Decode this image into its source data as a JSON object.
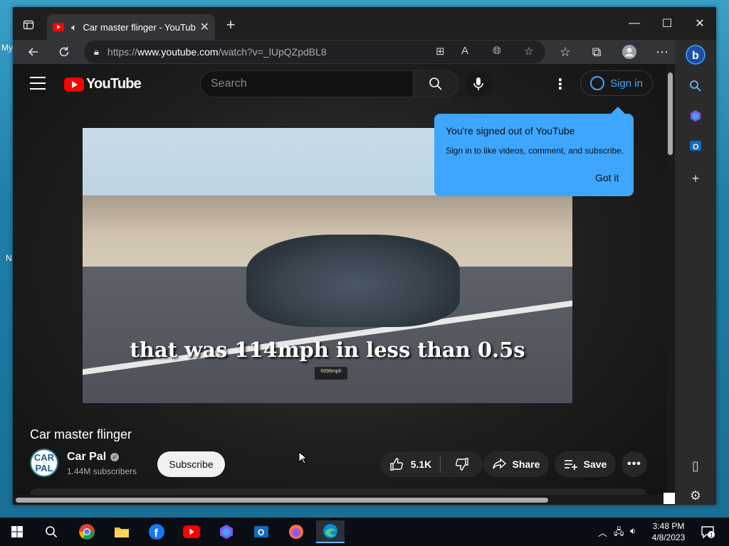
{
  "desktop": {
    "labels": [
      "My",
      "N"
    ]
  },
  "browser": {
    "tab_title": "Car master flinger - YouTube",
    "url_prefix": "https://",
    "url_host": "www.youtube.com",
    "url_path": "/watch?v=_lUpQZpdBL8"
  },
  "youtube": {
    "logo_text": "YouTube",
    "search_placeholder": "Search",
    "sign_in_label": "Sign in",
    "popup": {
      "title": "You're signed out of YouTube",
      "body": "Sign in to like videos, comment, and subscribe.",
      "button": "Got it"
    },
    "video": {
      "caption": "that was 114mph in less than 0.5s",
      "speedo": "0096mph",
      "title": "Car master flinger"
    },
    "channel": {
      "name": "Car Pal",
      "avatar_text": "CAR PAL",
      "subscribers": "1.44M subscribers",
      "subscribe_label": "Subscribe"
    },
    "actions": {
      "likes": "5.1K",
      "share_label": "Share",
      "save_label": "Save"
    }
  },
  "taskbar": {
    "time": "3:48 PM",
    "date": "4/8/2023",
    "notification_count": "1"
  },
  "colors": {
    "yt_red": "#ff0000",
    "popup_blue": "#3ea6ff",
    "page_bg": "#0f0f0f"
  }
}
